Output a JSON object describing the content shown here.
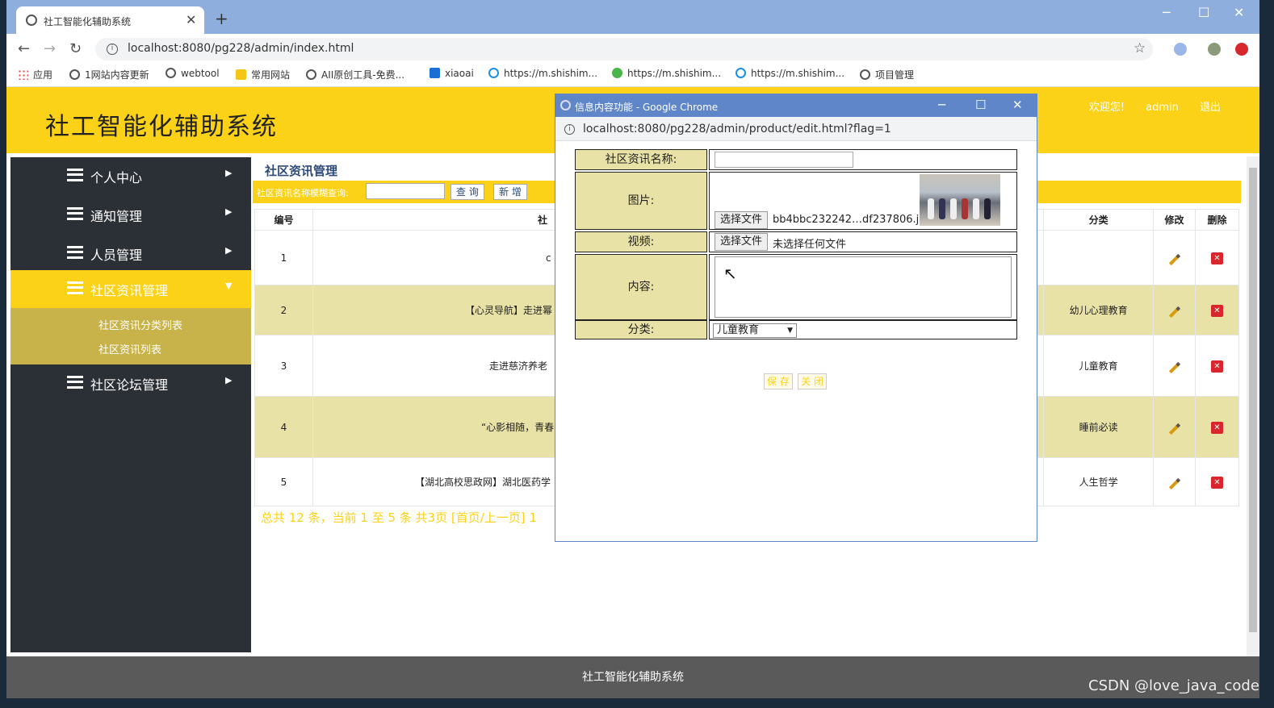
{
  "browser": {
    "tab_title": "社工智能化辅助系统",
    "tab_close": "✕",
    "new_tab": "+",
    "url": "localhost:8080/pg228/admin/index.html",
    "bookmarks": [
      "应用",
      "1网站内容更新",
      "webtool",
      "常用网站",
      "AII原创工具-免费...",
      "xiaoai",
      "https://m.shishim...",
      "https://m.shishim...",
      "https://m.shishim...",
      "项目管理"
    ]
  },
  "header": {
    "title": "社工智能化辅助系统",
    "welcome": "欢迎您!",
    "user": "admin",
    "logout": "退出"
  },
  "sidebar": {
    "items": [
      {
        "label": "个人中心",
        "arrow": "▶"
      },
      {
        "label": "通知管理",
        "arrow": "▶"
      },
      {
        "label": "人员管理",
        "arrow": "▶"
      },
      {
        "label": "社区资讯管理",
        "arrow": "▼"
      },
      {
        "label": "社区论坛管理",
        "arrow": "▶"
      }
    ],
    "subitems": [
      "社区资讯分类列表",
      "社区资讯列表"
    ]
  },
  "main": {
    "breadcrumb": "社区资讯管理",
    "search_label": "社区资讯名称模糊查询:",
    "search_button": "查 询",
    "add_button": "新 增",
    "columns": [
      "编号",
      "社",
      "分类",
      "修改",
      "删除"
    ],
    "rows": [
      {
        "id": "1",
        "title": "c",
        "category": ""
      },
      {
        "id": "2",
        "title": "【心灵导航】走进幂",
        "category": "幼儿心理教育"
      },
      {
        "id": "3",
        "title": "走进慈济养老",
        "category": "儿童教育"
      },
      {
        "id": "4",
        "title": "“心影相随，青春",
        "category": "睡前必读"
      },
      {
        "id": "5",
        "title": "【湖北高校思政网】湖北医药学",
        "category": "人生哲学"
      }
    ],
    "pager": "总共 12 条，当前 1 至 5 条 共3页 [首页/上一页] 1"
  },
  "popup": {
    "window_title": "信息内容功能 - Google Chrome",
    "url": "localhost:8080/pg228/admin/product/edit.html?flag=1",
    "fields": {
      "name_label": "社区资讯名称:",
      "name_value": "",
      "image_label": "图片:",
      "image_button": "选择文件",
      "image_file": "bb4bbc232242…df237806.jpg",
      "video_label": "视频:",
      "video_button": "选择文件",
      "video_file": "未选择任何文件",
      "content_label": "内容:",
      "content_value": "",
      "category_label": "分类:",
      "category_value": "儿童教育"
    },
    "save_button": "保 存",
    "close_button": "关 闭"
  },
  "footer": {
    "text": "社工智能化辅助系统"
  },
  "watermark": "CSDN @love_java_code",
  "colors": {
    "accent": "#fcd219",
    "sidebar": "#2b2f36",
    "row_alt": "#e9e2a6",
    "popup_title": "#5f86c8"
  }
}
